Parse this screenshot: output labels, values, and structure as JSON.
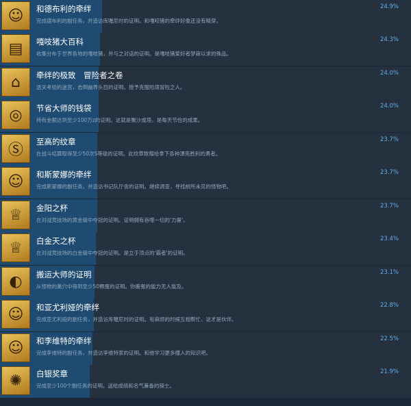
{
  "achievements": [
    {
      "title": "和德布利的牵绊",
      "desc": "完成德布利的副任务，并造访库喔尼时的证明。和嘎咬猪的牵绊好像还没有精穿。",
      "pct": "24.9%",
      "progress": 0.249,
      "icon": "character-portrait-icon"
    },
    {
      "title": "嘎吱猪大百科",
      "desc": "收集分布于世界各地的嘎吱猪，并与之对话的证明。是嘎吱猪爱好者梦寐以求的殊品。",
      "pct": "24.3%",
      "progress": 0.243,
      "icon": "book-icon"
    },
    {
      "title": "牵绊的极致　冒险者之卷",
      "desc": "透关考验的迷宫，击倒幽界头目的证明。授予克服险境冒险之人。",
      "pct": "24.0%",
      "progress": 0.24,
      "icon": "cave-icon"
    },
    {
      "title": "节省大师的钱袋",
      "desc": "持有金额达到至少100万z的证明。这就是聚沙成塔，是每天节俭的成果。",
      "pct": "24.0%",
      "progress": 0.24,
      "icon": "money-bag-icon"
    },
    {
      "title": "至高的纹章",
      "desc": "在战斗结算取得至少50次S等级的证明。此纹章致赠给拿下各种漂亮胜利的勇者。",
      "pct": "23.7%",
      "progress": 0.237,
      "icon": "s-crest-icon"
    },
    {
      "title": "和斯蒙娜的牵绊",
      "desc": "完成斯蒙娜的副任务，并造访书记队厅舍的证明。继续调查，寻找前所未见的怪物吧。",
      "pct": "23.7%",
      "progress": 0.237,
      "icon": "character-portrait-icon"
    },
    {
      "title": "金阳之杯",
      "desc": "在对战竞技场的黄金级中夺冠的证明。证明拥有吞噬一切的'力量'。",
      "pct": "23.7%",
      "progress": 0.237,
      "icon": "gold-cup-icon"
    },
    {
      "title": "白金天之杯",
      "desc": "在对战竞技场的白金级中夺冠的证明。是立于顶点的'霸者'的证明。",
      "pct": "23.4%",
      "progress": 0.234,
      "icon": "platinum-cup-icon"
    },
    {
      "title": "搬运大师的证明",
      "desc": "从怪物的巢穴中得到至少50颗蛋的证明。你搬蛋的能力无人能及。",
      "pct": "23.1%",
      "progress": 0.231,
      "icon": "egg-icon"
    },
    {
      "title": "和亚尤利娅的牵绊",
      "desc": "完成亚尤利娅的副任务，并造访库喔尼时的证明。有麻烦的时候互相帮忙，这才是伙伴。",
      "pct": "22.8%",
      "progress": 0.228,
      "icon": "character-portrait-icon"
    },
    {
      "title": "和李维特的牵绊",
      "desc": "完成李维特的副任务，并造访李维特家的证明。和他学习更多撞人的知识吧。",
      "pct": "22.5%",
      "progress": 0.225,
      "icon": "character-portrait-icon"
    },
    {
      "title": "白银奖章",
      "desc": "完成至少100个副任务的证明。送给成绩和名气兼备的骑士。",
      "pct": "21.9%",
      "progress": 0.219,
      "icon": "silver-medal-icon"
    }
  ]
}
